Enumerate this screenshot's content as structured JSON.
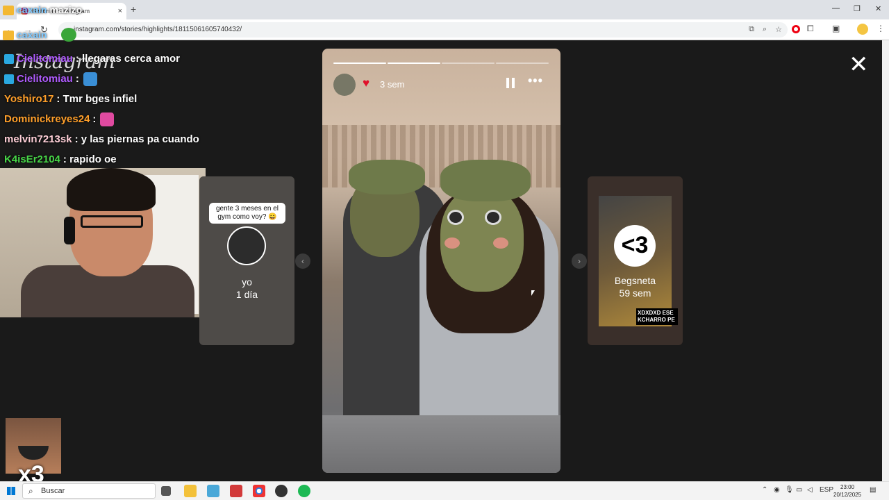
{
  "browser": {
    "tab_title": "Historias • Instagram",
    "tab_close": "×",
    "new_tab": "+",
    "url": "instagram.com/stories/highlights/18115061605740432/",
    "window_controls": [
      "—",
      "❐",
      "✕"
    ]
  },
  "overlay": {
    "top_left_line1_a": "caxain",
    "top_left_line1_b": "mazizo",
    "top_left_line2": "caxain"
  },
  "instagram": {
    "logo": "Instagram",
    "close": "✕"
  },
  "chat": [
    {
      "user": "Cielitomiau",
      "color": "#b05cff",
      "badge": true,
      "text": ": llegaras cerca amor",
      "emote": null
    },
    {
      "user": "Cielitomiau",
      "color": "#b05cff",
      "badge": true,
      "text": ":",
      "emote": "#3a8fd6"
    },
    {
      "user": "Yoshiro17",
      "color": "#ff9f2a",
      "badge": false,
      "text": ": Tmr bges infiel",
      "emote": null
    },
    {
      "user": "Dominickreyes24",
      "color": "#ff9f2a",
      "badge": false,
      "text": ":",
      "emote": "#e04aa0"
    },
    {
      "user": "melvin7213sk",
      "color": "#ffd0d8",
      "badge": false,
      "text": ": y las piernas pa cuando",
      "emote": null
    },
    {
      "user": "K4isEr2104",
      "color": "#48d848",
      "badge": false,
      "text": ": rapido oe",
      "emote": null
    }
  ],
  "stories": {
    "left": {
      "bubble": "gente 3 meses en el gym como voy? 😄",
      "name": "yo",
      "time": "1 día"
    },
    "current": {
      "time": "3 sem",
      "progress": [
        1,
        1,
        0,
        0
      ]
    },
    "right": {
      "big": "<3",
      "name": "Begsneta",
      "time": "59 sem",
      "caption": "XDXDXD ESE KCHARRO PE"
    }
  },
  "emote_counter": "x3",
  "taskbar": {
    "search_placeholder": "Buscar",
    "lang": "ESP",
    "time": "23:00",
    "date": "20/12/2025"
  }
}
